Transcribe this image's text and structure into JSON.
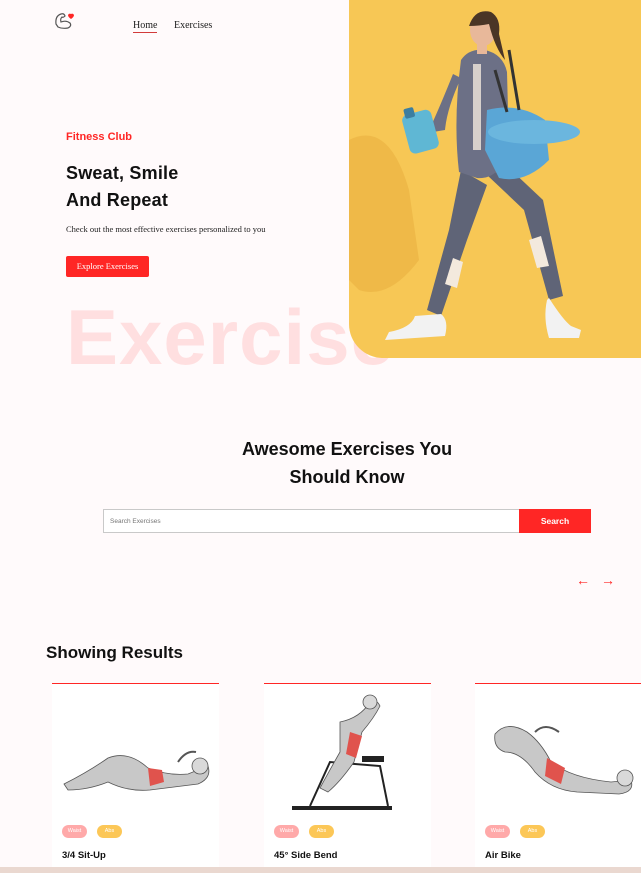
{
  "nav": {
    "home_label": "Home",
    "exercises_label": "Exercises"
  },
  "hero": {
    "kicker": "Fitness Club",
    "title_line1": "Sweat, Smile",
    "title_line2": "And Repeat",
    "description": "Check out the most effective exercises personalized to you",
    "cta_label": "Explore Exercises",
    "watermark": "Exercise"
  },
  "search": {
    "title_line1": "Awesome Exercises You",
    "title_line2": "Should Know",
    "placeholder": "Search Exercises",
    "button_label": "Search",
    "prev_arrow": "←",
    "next_arrow": "→"
  },
  "results": {
    "title": "Showing Results",
    "cards": [
      {
        "name": "3/4 Sit-Up",
        "tag1": "Waist",
        "tag2": "Abs"
      },
      {
        "name": "45° Side Bend",
        "tag1": "Waist",
        "tag2": "Abs"
      },
      {
        "name": "Air Bike",
        "tag1": "Waist",
        "tag2": "Abs"
      }
    ]
  },
  "colors": {
    "accent": "#ff2625",
    "banner": "#f7c755",
    "tag_waist": "#ffa9a9",
    "tag_abs": "#fcc757"
  },
  "icons": [
    "dumbbell-heart-logo",
    "arrow-left-icon",
    "arrow-right-icon"
  ]
}
